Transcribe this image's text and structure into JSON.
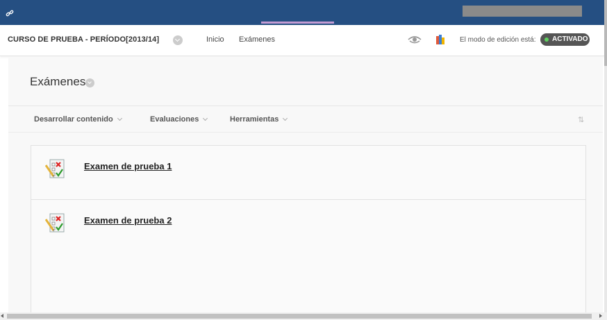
{
  "header": {
    "course_title": "CURSO DE PRUEBA - PERÍODO[2013/14]",
    "nav": [
      "Inicio",
      "Exámenes"
    ],
    "edit_mode_label": "El modo de edición está:",
    "edit_mode_state": "ACTIVADO"
  },
  "page": {
    "title": "Exámenes"
  },
  "menu": [
    {
      "label": "Desarrollar contenido"
    },
    {
      "label": "Evaluaciones"
    },
    {
      "label": "Herramientas"
    }
  ],
  "items": [
    {
      "title": "Examen de prueba 1",
      "icon": "test-icon"
    },
    {
      "title": "Examen de prueba 2",
      "icon": "test-icon"
    }
  ],
  "colors": {
    "topbar": "#254f82",
    "accent": "#c39bd3",
    "toggle_on": "#5fd35f"
  }
}
